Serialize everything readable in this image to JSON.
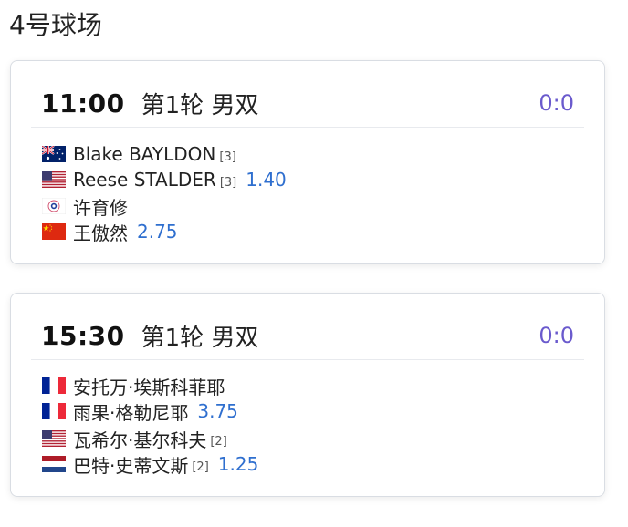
{
  "court": {
    "title": "4号球场"
  },
  "matches": [
    {
      "time": "11:00",
      "round": "第1轮 男双",
      "score": "0:0",
      "teams": [
        {
          "players": [
            {
              "name": "Blake BAYLDON",
              "seed": "[3]",
              "flag": "australia-flag-icon"
            },
            {
              "name": "Reese STALDER",
              "seed": "[3]",
              "flag": "usa-flag-icon"
            }
          ],
          "odds": "1.40"
        },
        {
          "players": [
            {
              "name": "许育修",
              "seed": "",
              "flag": "chinese-taipei-flag-icon"
            },
            {
              "name": "王傲然",
              "seed": "",
              "flag": "china-flag-icon"
            }
          ],
          "odds": "2.75"
        }
      ]
    },
    {
      "time": "15:30",
      "round": "第1轮 男双",
      "score": "0:0",
      "teams": [
        {
          "players": [
            {
              "name": "安托万·埃斯科菲耶",
              "seed": "",
              "flag": "france-flag-icon"
            },
            {
              "name": "雨果·格勒尼耶",
              "seed": "",
              "flag": "france-flag-icon"
            }
          ],
          "odds": "3.75"
        },
        {
          "players": [
            {
              "name": "瓦希尔·基尔科夫",
              "seed": "[2]",
              "flag": "usa-flag-icon"
            },
            {
              "name": "巴特·史蒂文斯",
              "seed": "[2]",
              "flag": "netherlands-flag-icon"
            }
          ],
          "odds": "1.25"
        }
      ]
    }
  ],
  "colors": {
    "score": "#6a5acd",
    "odds": "#2f6fcf",
    "card_border": "#d9dde3"
  }
}
